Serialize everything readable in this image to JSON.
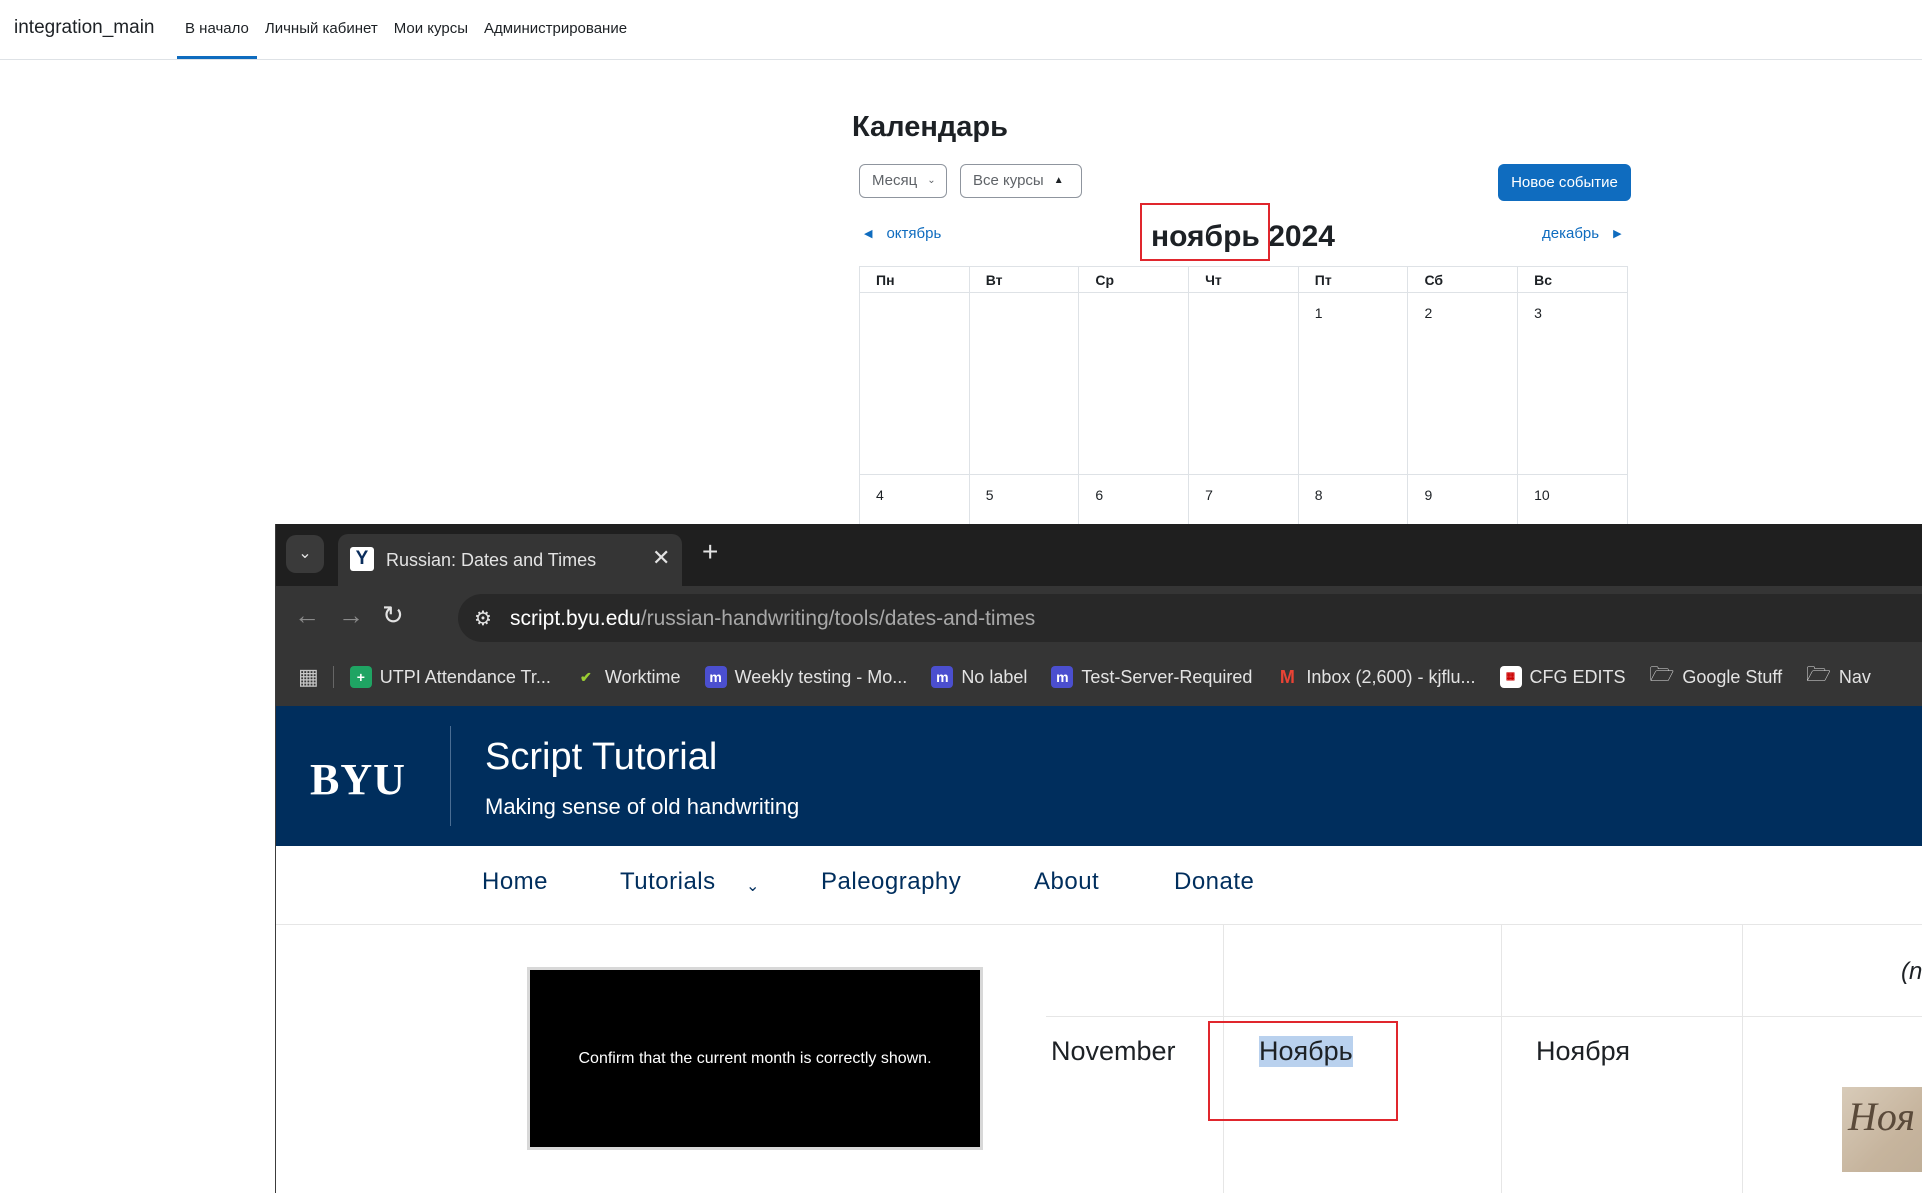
{
  "moodle": {
    "brand": "integration_main",
    "nav": [
      "В начало",
      "Личный кабинет",
      "Мои курсы",
      "Администрирование"
    ],
    "calendar_title": "Календарь",
    "view_select": "Месяц",
    "course_select": "Все курсы",
    "new_event": "Новое событие",
    "prev_month": "октябрь",
    "next_month": "декабрь",
    "current_month": "ноябрь",
    "current_year": "2024",
    "weekdays": [
      "Пн",
      "Вт",
      "Ср",
      "Чт",
      "Пт",
      "Сб",
      "Вс"
    ],
    "week1": [
      "",
      "",
      "",
      "",
      "1",
      "2",
      "3"
    ],
    "week2": [
      "4",
      "5",
      "6",
      "7",
      "8",
      "9",
      "10"
    ]
  },
  "browser": {
    "tab_title": "Russian: Dates and Times",
    "tab_favicon": "Y",
    "url_host": "script.byu.edu",
    "url_path": "/russian-handwriting/tools/dates-and-times",
    "bookmarks": [
      "UTPI Attendance Tr...",
      "Worktime",
      "Weekly testing - Mo...",
      "No label",
      "Test-Server-Required",
      "Inbox (2,600) - kjflu...",
      "CFG EDITS",
      "Google Stuff",
      "Nav"
    ]
  },
  "site": {
    "logo": "BYU",
    "title": "Script Tutorial",
    "subtitle": "Making sense of old handwriting",
    "nav": [
      "Home",
      "Tutorials",
      "Paleography",
      "About",
      "Donate"
    ],
    "overlay_text": "Confirm that the current month is correctly shown.",
    "row_english": "November",
    "row_nominative": "Ноябрь",
    "row_genitive": "Ноября",
    "header_partial": "(n",
    "thumb_text": "Ноя"
  },
  "colors": {
    "moodle_primary": "#0f6cbf",
    "byu_navy": "#002e5d",
    "highlight": "#e0262d"
  }
}
